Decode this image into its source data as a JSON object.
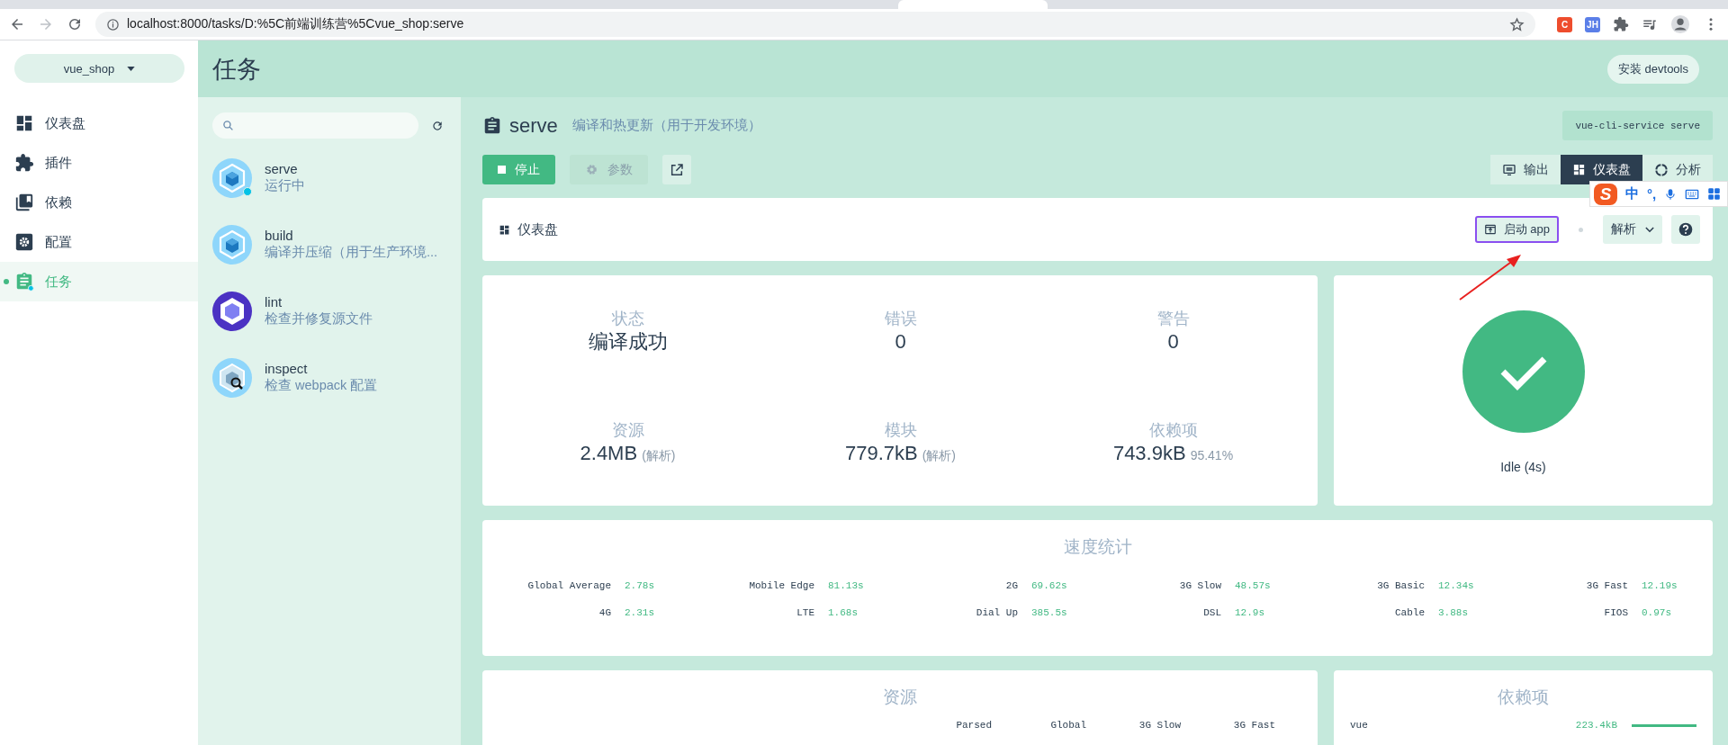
{
  "browser": {
    "url": "localhost:8000/tasks/D:%5C前端训练营%5Cvue_shop:serve",
    "extensions": [
      {
        "label": "C",
        "color": "#ee4d2d"
      },
      {
        "label": "JH",
        "color": "#5b7fe8"
      }
    ]
  },
  "project": {
    "name": "vue_shop"
  },
  "nav": [
    {
      "label": "仪表盘",
      "kind": "dashboard",
      "selected": false
    },
    {
      "label": "插件",
      "kind": "plugins",
      "selected": false
    },
    {
      "label": "依赖",
      "kind": "dependencies",
      "selected": false
    },
    {
      "label": "配置",
      "kind": "config",
      "selected": false
    },
    {
      "label": "任务",
      "kind": "tasks",
      "selected": true
    }
  ],
  "page_title": "任务",
  "devtools_button": "安装 devtools",
  "tasks": [
    {
      "name": "serve",
      "description": "运行中",
      "kind": "webpack",
      "running": true
    },
    {
      "name": "build",
      "description": "编译并压缩（用于生产环境...",
      "kind": "webpack",
      "running": false
    },
    {
      "name": "lint",
      "description": "检查并修复源文件",
      "kind": "eslint",
      "running": false
    },
    {
      "name": "inspect",
      "description": "检查 webpack 配置",
      "kind": "inspect",
      "running": false
    }
  ],
  "task": {
    "name": "serve",
    "description": "编译和热更新（用于开发环境）",
    "command": "vue-cli-service serve"
  },
  "actions": [
    {
      "label": "停止",
      "kind": "stop",
      "disabled": false
    },
    {
      "label": "参数",
      "kind": "params",
      "disabled": true
    },
    {
      "kind": "open",
      "disabled": false
    }
  ],
  "views": [
    {
      "label": "输出",
      "kind": "output",
      "selected": false
    },
    {
      "label": "仪表盘",
      "kind": "dashboard",
      "selected": true
    },
    {
      "label": "分析",
      "kind": "analyze",
      "selected": false
    }
  ],
  "dashboard": {
    "title": "仪表盘",
    "launch_button": "启动 app",
    "mode_select": "解析"
  },
  "stats": [
    {
      "label": "状态",
      "value": "编译成功"
    },
    {
      "label": "错误",
      "value": "0"
    },
    {
      "label": "警告",
      "value": "0"
    },
    {
      "label": "资源",
      "value": "2.4MB",
      "note": "(解析)"
    },
    {
      "label": "模块",
      "value": "779.7kB",
      "note": "(解析)"
    },
    {
      "label": "依赖项",
      "value": "743.9kB",
      "note": "95.41%"
    }
  ],
  "status": {
    "text": "Idle (4s)"
  },
  "speed": {
    "title": "速度统计",
    "items": [
      {
        "label": "Global Average",
        "value": "2.78s"
      },
      {
        "label": "Mobile Edge",
        "value": "81.13s"
      },
      {
        "label": "2G",
        "value": "69.62s"
      },
      {
        "label": "3G Slow",
        "value": "48.57s"
      },
      {
        "label": "3G Basic",
        "value": "12.34s"
      },
      {
        "label": "3G Fast",
        "value": "12.19s"
      },
      {
        "label": "4G",
        "value": "2.31s"
      },
      {
        "label": "LTE",
        "value": "1.68s"
      },
      {
        "label": "Dial Up",
        "value": "385.5s"
      },
      {
        "label": "DSL",
        "value": "12.9s"
      },
      {
        "label": "Cable",
        "value": "3.88s"
      },
      {
        "label": "FIOS",
        "value": "0.97s"
      }
    ]
  },
  "assets": {
    "title": "资源",
    "columns": [
      "Parsed",
      "Global",
      "3G Slow",
      "3G Fast"
    ]
  },
  "dependencies": {
    "title": "依赖项",
    "items": [
      {
        "name": "vue",
        "size": "223.4kB",
        "level": 1
      }
    ]
  },
  "ime": {
    "logo": "S",
    "mode": "中",
    "punct": "°,"
  }
}
